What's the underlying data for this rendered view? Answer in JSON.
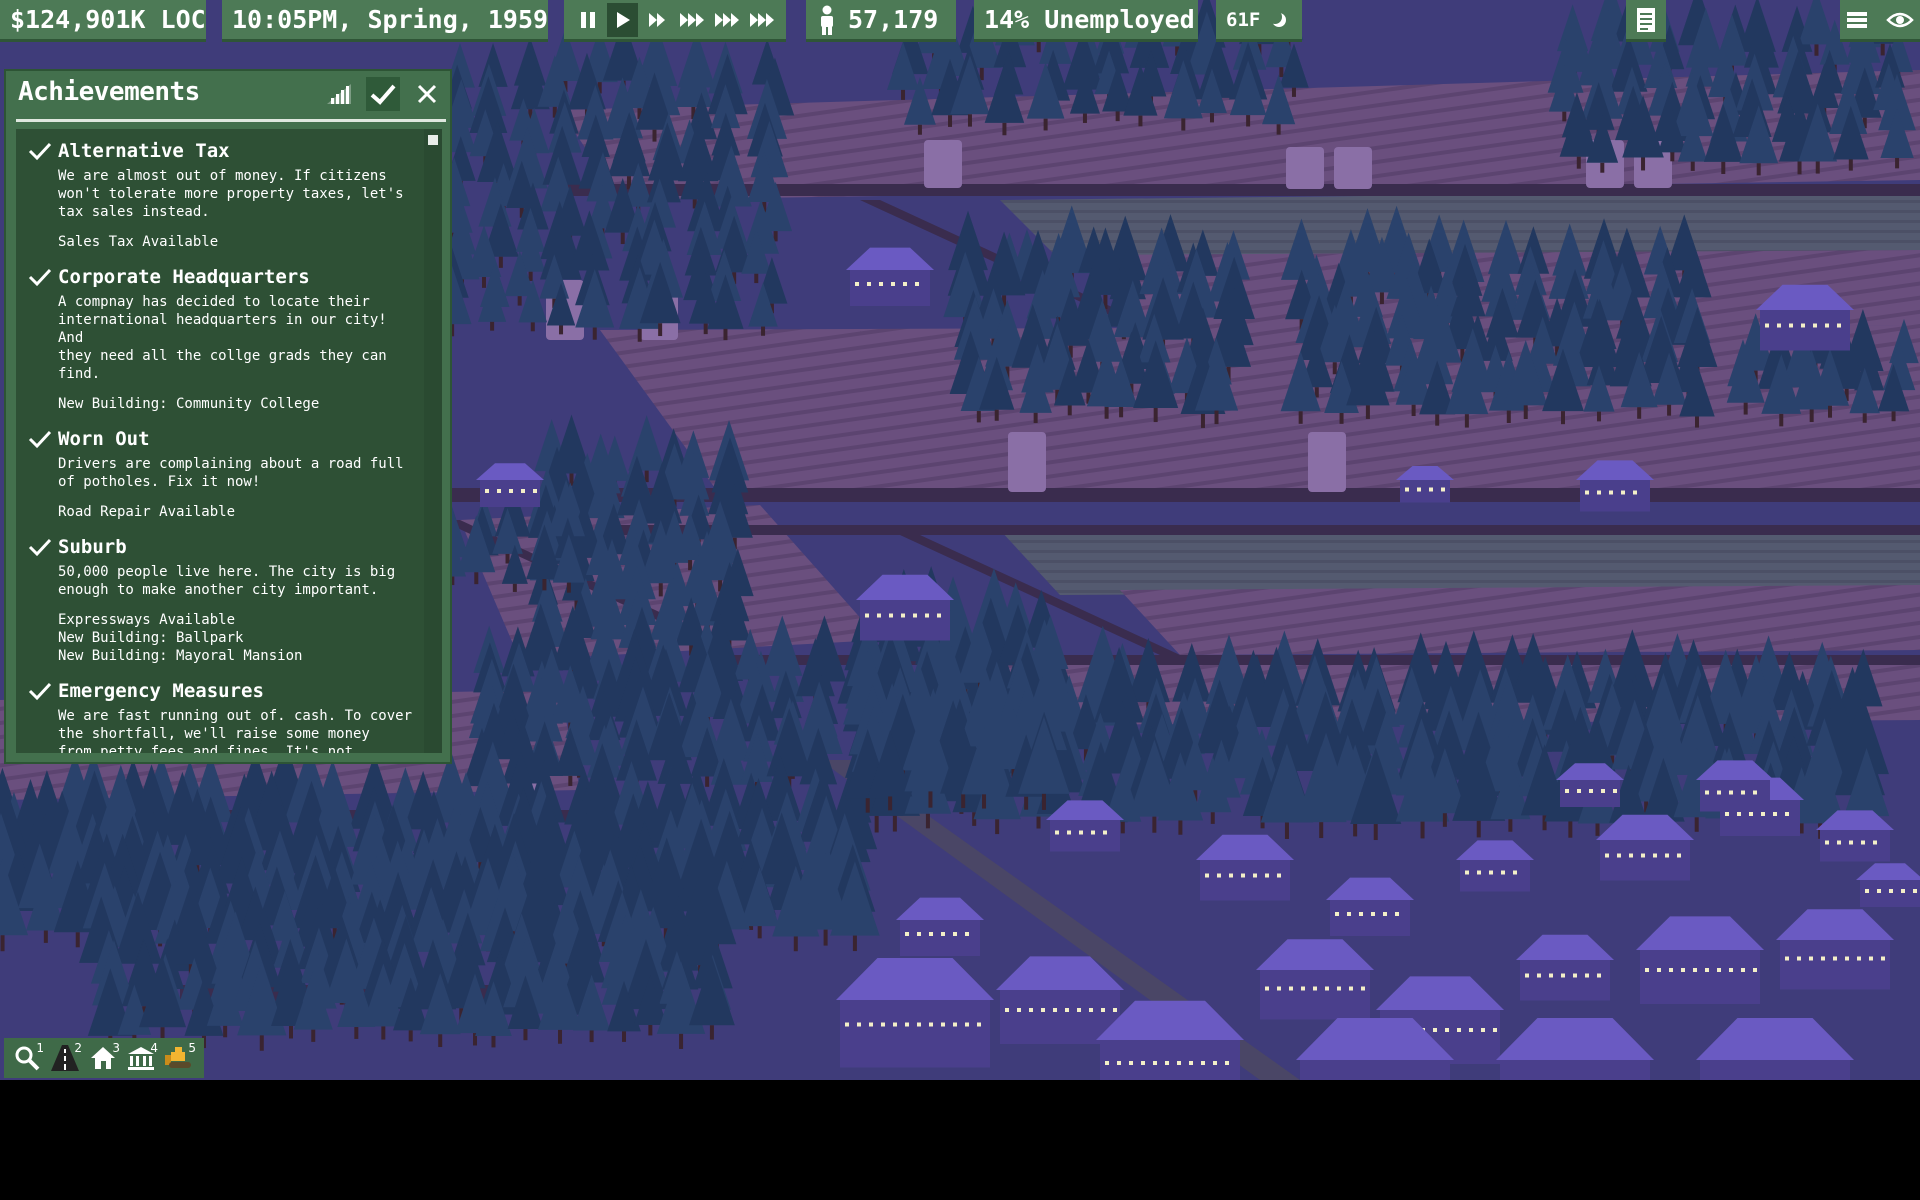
{
  "hud": {
    "money": "$124,901K LOC",
    "datetime": "10:05PM, Spring, 1959",
    "population": "57,179",
    "unemployment": "14% Unemployed",
    "temperature": "61F",
    "speed_active": "play"
  },
  "icons": {
    "pause": "pause-icon",
    "play": "play-icon",
    "fast": "fast-forward-icon",
    "population": "person-icon",
    "weather": "moon-icon",
    "report": "document-icon",
    "menu": "menu-icon",
    "view": "eye-icon"
  },
  "achievements": {
    "title": "Achievements",
    "items": [
      {
        "name": "Alternative Tax",
        "description": "We are almost out of money. If citizens\nwon't tolerate more property taxes, let's\ntax sales instead.",
        "unlocks": [
          "Sales Tax Available"
        ]
      },
      {
        "name": "Corporate Headquarters",
        "description": "A compnay has decided to locate their\ninternational headquarters in our city! And\nthey need all the collge grads they can\nfind.",
        "unlocks": [
          "New Building: Community College"
        ]
      },
      {
        "name": "Worn Out",
        "description": "Drivers are complaining about a road full\nof potholes. Fix it now!",
        "unlocks": [
          "Road Repair Available"
        ]
      },
      {
        "name": "Suburb",
        "description": "50,000 people live here. The city is big\nenough to make another city important.",
        "unlocks": [
          "Expressways Available",
          "New Building: Ballpark",
          "New Building: Mayoral Mansion"
        ]
      },
      {
        "name": "Emergency Measures",
        "description": "We are fast running out of. cash. To cover\nthe shortfall, we'll raise some money\nfrom petty fees and fines. It's not",
        "unlocks": []
      }
    ]
  },
  "tools": [
    {
      "icon": "search-icon",
      "key": "1"
    },
    {
      "icon": "road-icon",
      "key": "2"
    },
    {
      "icon": "house-icon",
      "key": "3"
    },
    {
      "icon": "government-icon",
      "key": "4"
    },
    {
      "icon": "bulldozer-icon",
      "key": "5"
    }
  ],
  "colors": {
    "panel_green": "#43704d",
    "panel_dark": "#2e5035",
    "night_ground": "#3e3b78",
    "field": "#6a4d7c",
    "tree": "#233a62",
    "house_roof": "#6a5ac2"
  }
}
